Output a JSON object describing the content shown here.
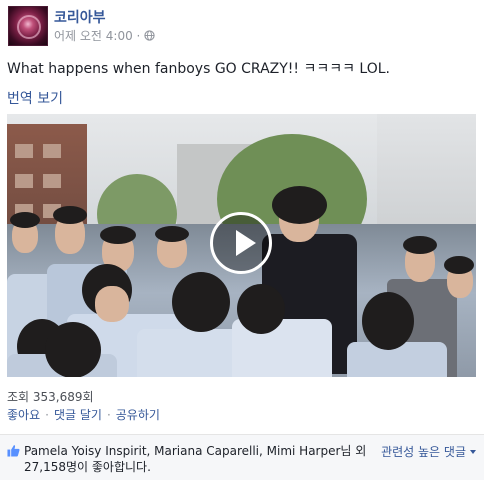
{
  "header": {
    "page_name": "코리아부",
    "timestamp": "어제 오전 4:00 ·",
    "privacy_icon": "globe-icon"
  },
  "post": {
    "message": "What happens when fanboys GO CRAZY!! ㅋㅋㅋㅋ LOL.",
    "translate_label": "번역 보기"
  },
  "video": {
    "play_icon": "play-icon"
  },
  "stats": {
    "views": "조회 353,689회"
  },
  "actions": {
    "like": "좋아요",
    "sep1": "·",
    "comment": "댓글 달기",
    "sep2": "·",
    "share": "공유하기"
  },
  "likes": {
    "icon": "thumbs-up-icon",
    "names": "Pamela Yoisy Inspirit, Mariana Caparelli, Mimi Harper",
    "suffix": "님 외",
    "count": "27,158명이 좋아합니다.",
    "sort_label": "관련성 높은 댓글"
  },
  "colors": {
    "link": "#365899",
    "meta": "#90949c",
    "text": "#1d2129",
    "likes_bg": "#f6f7f9"
  }
}
